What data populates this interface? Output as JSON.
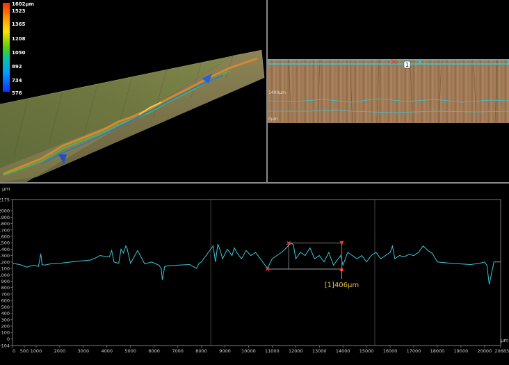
{
  "legend": {
    "labels": [
      "1602µm",
      "1523",
      "1365",
      "1208",
      "1050",
      "892",
      "734",
      "576"
    ],
    "colors": {
      "max": "#ff2a00",
      "min": "#1030ff"
    }
  },
  "topview": {
    "marker_label": "1",
    "scale_labels": [
      "1400µm",
      "0µm"
    ],
    "profile_line_color": "#35c8e0"
  },
  "profile": {
    "y_unit": "µm",
    "x_unit": "µm",
    "measurement_label": "[1]406µm",
    "colors": {
      "trace": "#3cc8d8",
      "marker": "#ff3030",
      "measurement": "#e8c040",
      "grid": "#555555"
    }
  },
  "chart_data": {
    "type": "line",
    "xlabel": "µm",
    "ylabel": "µm",
    "xlim": [
      0,
      20683
    ],
    "ylim": [
      -104,
      2175
    ],
    "grid": false,
    "x_ticks": [
      0,
      500,
      1000,
      2000,
      3000,
      4000,
      5000,
      6000,
      7000,
      8000,
      9000,
      10000,
      11000,
      12000,
      13000,
      14000,
      15000,
      16000,
      17000,
      18000,
      19000,
      20000,
      20683
    ],
    "y_ticks": [
      -104,
      0,
      100,
      200,
      300,
      400,
      500,
      600,
      700,
      800,
      900,
      1000,
      1100,
      1200,
      1300,
      1400,
      1500,
      1600,
      1700,
      1800,
      1900,
      2000,
      2175
    ],
    "series": [
      {
        "x": [
          0,
          300,
          600,
          900,
          1100,
          1200,
          1250,
          1350,
          1600,
          2000,
          2500,
          3000,
          3300,
          3500,
          3700,
          4100,
          4200,
          4300,
          4500,
          4600,
          4700,
          4800,
          4850,
          5000,
          5300,
          5600,
          5900,
          6200,
          6300,
          6350,
          6450,
          6600,
          7000,
          7500,
          7800,
          7900,
          8000,
          8100,
          8300,
          8500,
          8600,
          8700,
          8800,
          8900,
          9100,
          9300,
          9400,
          9500,
          9700,
          9900,
          10100,
          10300,
          10600,
          10800,
          11000,
          11200,
          11400,
          11600,
          11800,
          11900,
          12000,
          12200,
          12400,
          12600,
          12800,
          13000,
          13200,
          13400,
          13600,
          13800,
          13900,
          14000,
          14200,
          14400,
          14600,
          14800,
          15000,
          15200,
          15400,
          15600,
          15800,
          16000,
          16100,
          16200,
          16400,
          16600,
          16800,
          17000,
          17200,
          17400,
          17600,
          17800,
          18000,
          18300,
          18600,
          19000,
          19400,
          19800,
          20000,
          20100,
          20200,
          20400,
          20683
        ],
        "y": [
          1180,
          1160,
          1120,
          1150,
          1130,
          1330,
          1160,
          1150,
          1170,
          1180,
          1200,
          1220,
          1230,
          1260,
          1300,
          1280,
          1380,
          1200,
          1180,
          1400,
          1340,
          1450,
          1420,
          1180,
          1380,
          1170,
          1200,
          1150,
          1100,
          920,
          1130,
          1140,
          1150,
          1160,
          1100,
          1180,
          1200,
          1250,
          1350,
          1450,
          1200,
          1480,
          1380,
          1250,
          1400,
          1300,
          1420,
          1350,
          1250,
          1380,
          1300,
          1350,
          1200,
          1100,
          1250,
          1300,
          1350,
          1420,
          1500,
          1470,
          1250,
          1350,
          1300,
          1420,
          1250,
          1300,
          1200,
          1350,
          1150,
          1250,
          1300,
          1150,
          1350,
          1300,
          1250,
          1300,
          1200,
          1300,
          1350,
          1250,
          1300,
          1350,
          1450,
          1250,
          1300,
          1280,
          1320,
          1300,
          1350,
          1450,
          1380,
          1330,
          1200,
          1190,
          1180,
          1170,
          1160,
          1180,
          1200,
          1150,
          850,
          1200,
          1200
        ]
      }
    ],
    "annotations": [
      {
        "type": "point",
        "x": 10800,
        "y": 1090,
        "color": "#ff3030"
      },
      {
        "type": "point",
        "x": 11700,
        "y": 1496,
        "color": "#ff3030"
      },
      {
        "type": "height",
        "x": 13950,
        "y_low": 1090,
        "y_high": 1496,
        "label": "[1]406µm"
      }
    ]
  }
}
